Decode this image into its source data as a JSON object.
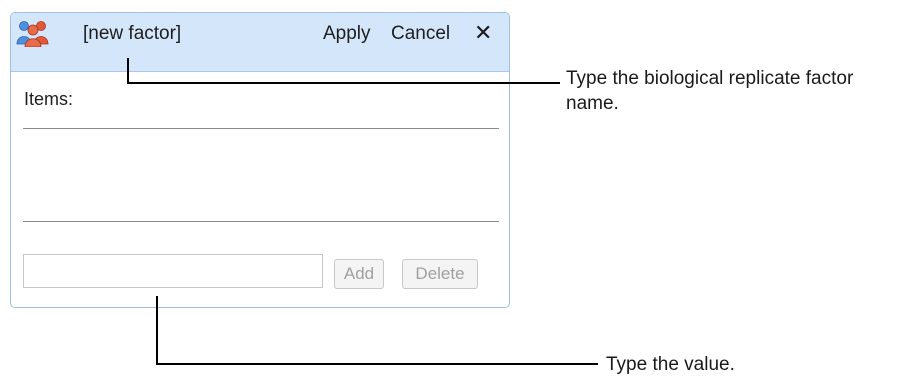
{
  "factor_editor": {
    "icon": "biological-replicate-people-icon",
    "name_value": "[new factor]",
    "apply_label": "Apply",
    "cancel_label": "Cancel",
    "close_glyph": "✕",
    "items_label": "Items:",
    "value_input": {
      "value": "",
      "placeholder": ""
    },
    "add_label": "Add",
    "delete_label": "Delete"
  },
  "callouts": {
    "name_hint": "Type the biological replicate factor name.",
    "value_hint": "Type the value."
  },
  "colors": {
    "titlebar_bg": "#d4e6f9",
    "panel_border": "#9ec0e3",
    "icon_blue": "#3a7ed6",
    "icon_red": "#d9462c",
    "disabled_text": "#a0a0a0"
  }
}
